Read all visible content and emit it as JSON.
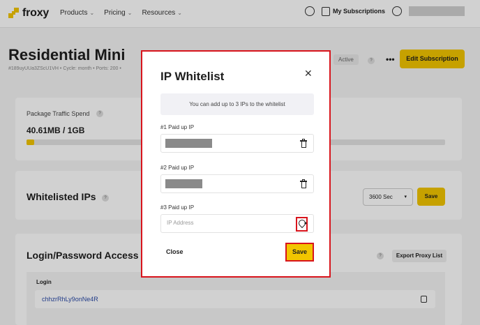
{
  "header": {
    "logo": "froxy",
    "nav": [
      {
        "label": "Products"
      },
      {
        "label": "Pricing"
      },
      {
        "label": "Resources"
      }
    ],
    "subscriptions_label": "My Subscriptions"
  },
  "subscription": {
    "title": "Residential Mini",
    "meta": "#189uyUUa3ZScU1VH  •  Cycle: month  •  Ports: 200  •",
    "status": "Active",
    "edit_label": "Edit Subscription",
    "more_label": "•••"
  },
  "traffic": {
    "label": "Package Traffic Spend",
    "value": "40.61MB / 1GB",
    "used_fraction": 0.018
  },
  "whitelisted": {
    "title": "Whitelisted IPs",
    "interval": "3600 Sec",
    "save_label": "Save"
  },
  "login_access": {
    "title": "Login/Password Access",
    "export_label": "Export Proxy List",
    "login_label": "Login",
    "login_value": "chhzrRhLy9onNe4R"
  },
  "modal": {
    "title": "IP Whitelist",
    "info": "You can add up to 3 IPs to the whitelist",
    "slots": [
      {
        "label": "#1 Paid up IP"
      },
      {
        "label": "#2 Paid up IP"
      },
      {
        "label": "#3 Paid up IP",
        "placeholder": "IP Address"
      }
    ],
    "close_label": "Close",
    "save_label": "Save"
  },
  "colors": {
    "accent": "#f2c500",
    "highlight": "#d8141c",
    "link": "#2b4ba8"
  }
}
